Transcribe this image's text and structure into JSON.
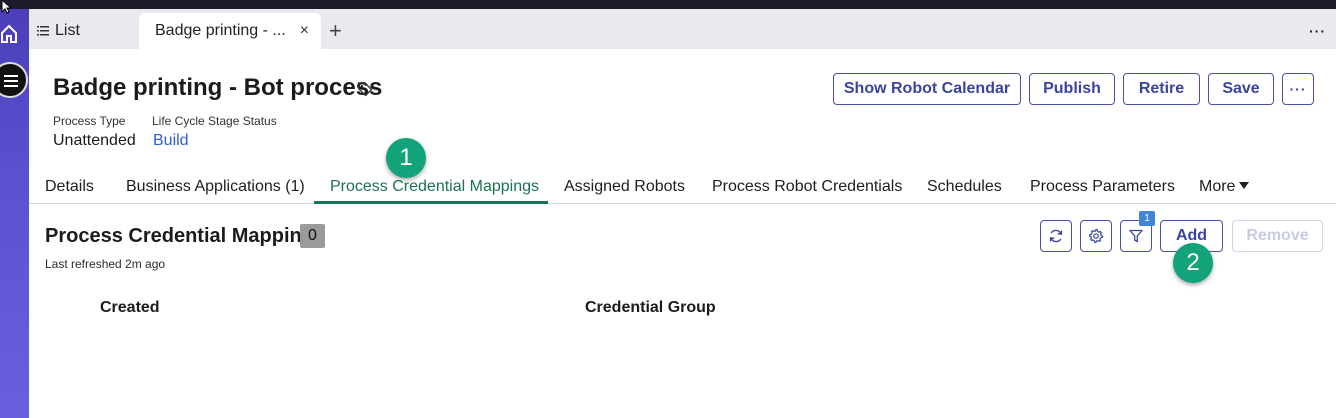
{
  "tabs": {
    "list_label": "List",
    "active_label": "Badge printing - ...",
    "close_glyph": "×",
    "add_glyph": "+",
    "more_glyph": "···"
  },
  "page": {
    "title": "Badge printing - Bot process",
    "meta": [
      {
        "label": "Process Type",
        "value": "Unattended"
      },
      {
        "label": "Life Cycle Stage Status",
        "value": "Build"
      }
    ]
  },
  "actions": {
    "show_robot_calendar": "Show Robot Calendar",
    "publish": "Publish",
    "retire": "Retire",
    "save": "Save",
    "more": "···"
  },
  "subtabs": [
    {
      "label": "Details"
    },
    {
      "label": "Business Applications (1)"
    },
    {
      "label": "Process Credential Mappings",
      "active": true
    },
    {
      "label": "Assigned Robots"
    },
    {
      "label": "Process Robot Credentials"
    },
    {
      "label": "Schedules"
    },
    {
      "label": "Process Parameters"
    },
    {
      "label": "More"
    }
  ],
  "section": {
    "title": "Process Credential Mappings",
    "count": "0",
    "last_refreshed": "Last refreshed 2m ago",
    "filter_count": "1",
    "add_label": "Add",
    "remove_label": "Remove",
    "columns": [
      "Created",
      "Credential Group"
    ]
  },
  "callouts": [
    "1",
    "2"
  ],
  "colors": {
    "accent": "#3b43a0",
    "active_tab": "#19744f",
    "callout": "#12a37b",
    "link": "#2f5bd6",
    "rail": "#5b50d0"
  }
}
